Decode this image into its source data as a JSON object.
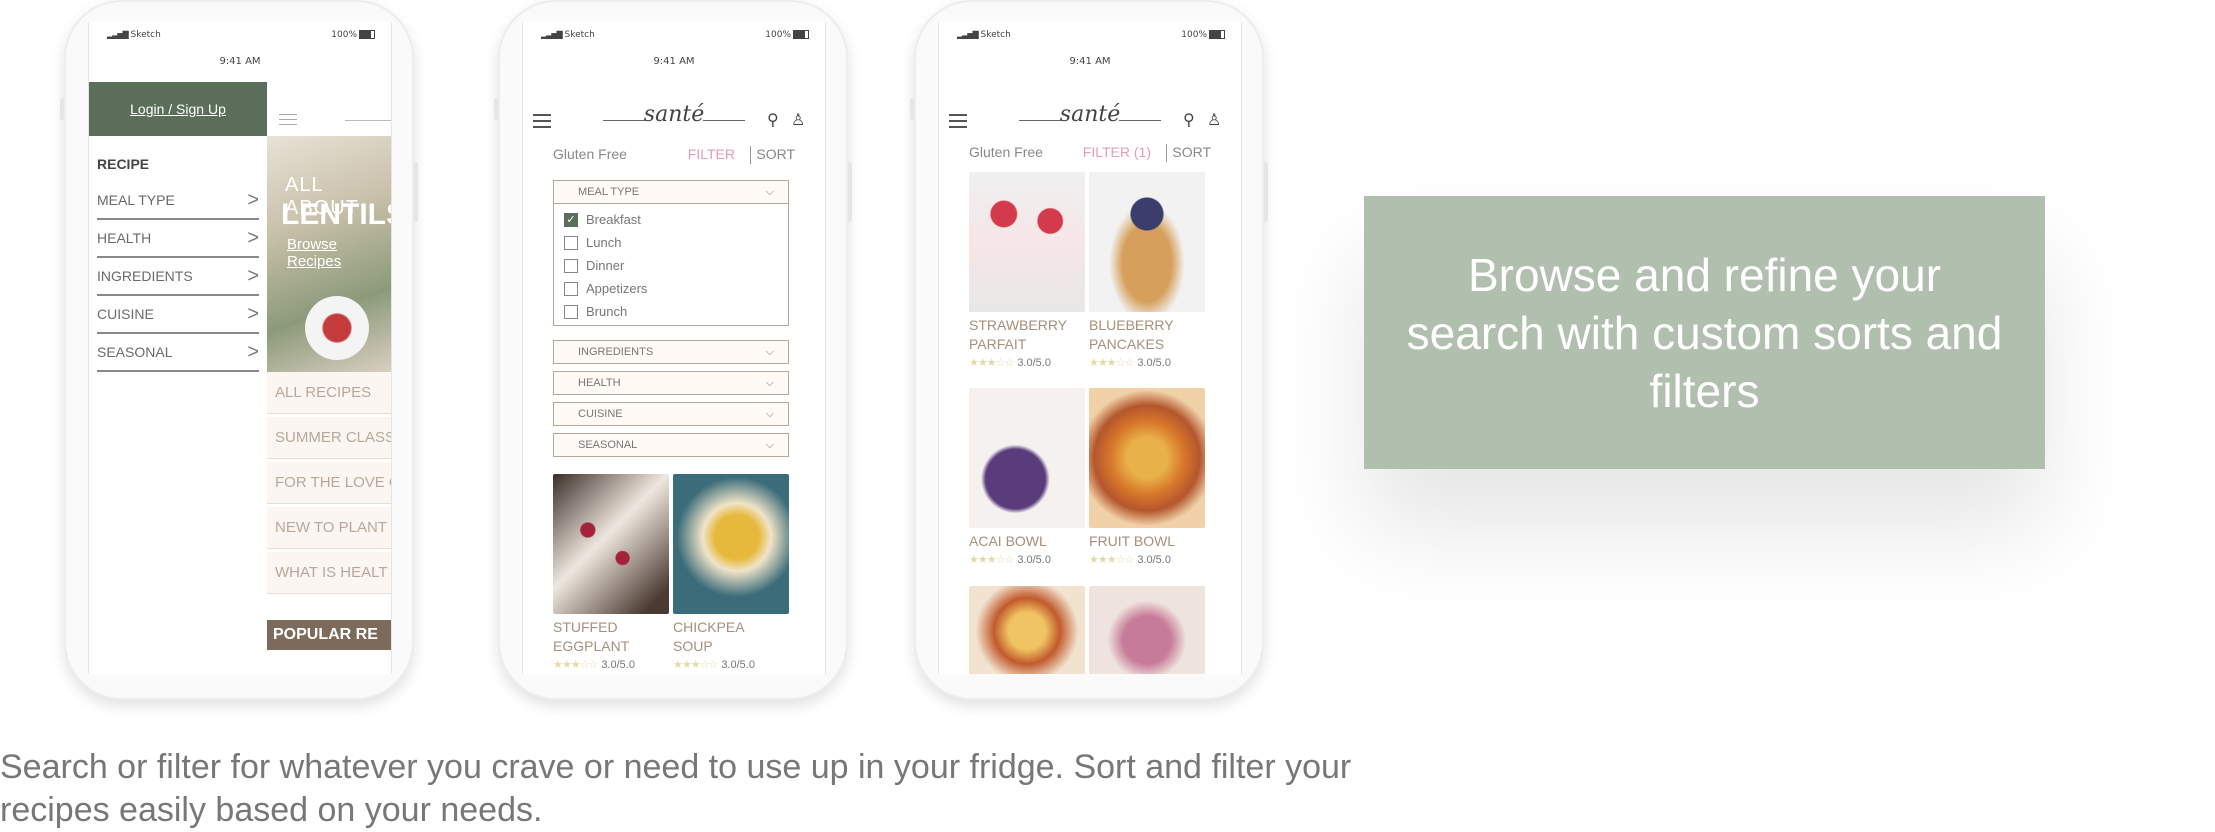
{
  "status": {
    "carrier": "Sketch",
    "time": "9:41 AM",
    "battery": "100%"
  },
  "brand": {
    "logo": "santé"
  },
  "colors": {
    "accent": "#5b6e59",
    "filter_pink": "#e59cb9",
    "card_bg": "#b1bfae"
  },
  "menu_phone": {
    "login_label": "Login / Sign Up",
    "menu_title": "RECIPE",
    "items": [
      "MEAL TYPE",
      "HEALTH",
      "INGREDIENTS",
      "CUISINE",
      "SEASONAL"
    ],
    "hero": {
      "line1": "ALL ABOUT",
      "line2": "LENTILS",
      "link": "Browse Recipes"
    },
    "links": [
      "ALL RECIPES",
      "SUMMER CLASS",
      "FOR THE LOVE O",
      "NEW TO PLANT",
      "WHAT IS HEALT"
    ],
    "popular": "POPULAR RE"
  },
  "filter_phone": {
    "toolbar": {
      "diet": "Gluten Free",
      "filter": "FILTER",
      "sort": "SORT"
    },
    "meal_type": {
      "label": "MEAL TYPE",
      "options": [
        {
          "label": "Breakfast",
          "checked": true
        },
        {
          "label": "Lunch",
          "checked": false
        },
        {
          "label": "Dinner",
          "checked": false
        },
        {
          "label": "Appetizers",
          "checked": false
        },
        {
          "label": "Brunch",
          "checked": false
        }
      ]
    },
    "collapsed": [
      "INGREDIENTS",
      "HEALTH",
      "CUISINE",
      "SEASONAL"
    ],
    "recipes": [
      {
        "line1": "STUFFED",
        "line2": "EGGPLANT",
        "rating": "3.0/5.0"
      },
      {
        "line1": "CHICKPEA",
        "line2": "SOUP",
        "rating": "3.0/5.0"
      }
    ]
  },
  "results_phone": {
    "toolbar": {
      "diet": "Gluten Free",
      "filter": "FILTER (1)",
      "sort": "SORT"
    },
    "recipes": [
      {
        "line1": "STRAWBERRY",
        "line2": "PARFAIT",
        "rating": "3.0/5.0"
      },
      {
        "line1": "BLUEBERRY",
        "line2": "PANCAKES",
        "rating": "3.0/5.0"
      },
      {
        "line1": "ACAI BOWL",
        "line2": "",
        "rating": "3.0/5.0"
      },
      {
        "line1": "FRUIT BOWL",
        "line2": "",
        "rating": "3.0/5.0"
      }
    ]
  },
  "card": {
    "text": "Browse and refine your search with custom sorts and filters"
  },
  "caption": "Search or filter for whatever you crave or need to use up in your fridge. Sort and filter your recipes easily based on your needs."
}
